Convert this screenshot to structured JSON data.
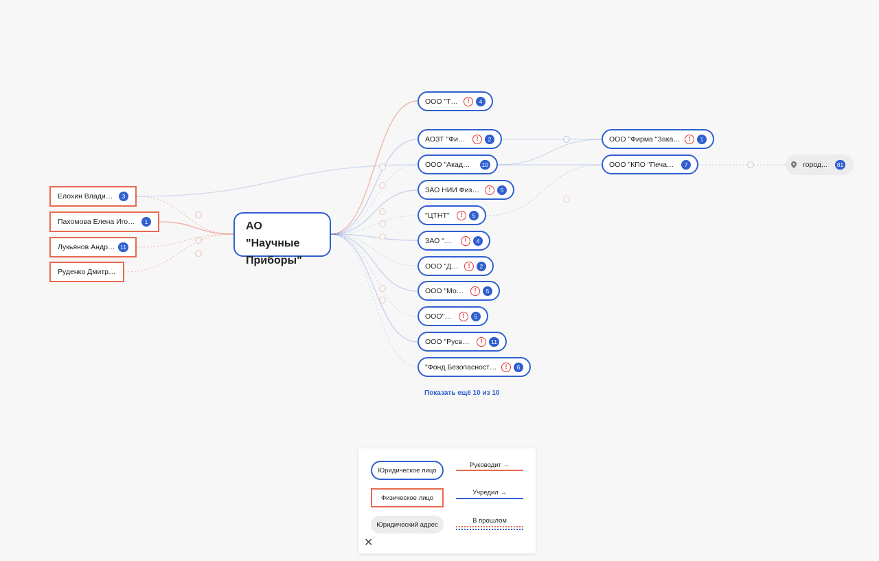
{
  "center": {
    "label": "АО \"Научные Приборы\""
  },
  "persons": [
    {
      "id": "p1",
      "label": "Елохин Владимир...",
      "badge": "3"
    },
    {
      "id": "p2",
      "label": "Пахомова Елена Игоревна",
      "badge": "1"
    },
    {
      "id": "p3",
      "label": "Лукьянов Андрей...",
      "badge": "11"
    },
    {
      "id": "p4",
      "label": "Руденко Дмитрий..."
    }
  ],
  "companies": [
    {
      "id": "c1",
      "label": "ООО \"ТДАЭ\"",
      "warn": true,
      "badge": "4"
    },
    {
      "id": "c2",
      "label": "АОЗТ \"Фирма...",
      "warn": true,
      "badge": "2"
    },
    {
      "id": "c3",
      "label": "ООО \"Академия\"",
      "warn": false,
      "badge": "10"
    },
    {
      "id": "c4",
      "label": "ЗАО НИИ Физики...",
      "warn": true,
      "badge": "5"
    },
    {
      "id": "c5",
      "label": "\"ЦТНТ\"",
      "warn": true,
      "badge": "5"
    },
    {
      "id": "c6",
      "label": "ЗАО \"СКБ...",
      "warn": true,
      "badge": "4"
    },
    {
      "id": "c7",
      "label": "ООО \"Джем\"",
      "warn": true,
      "badge": "2"
    },
    {
      "id": "c8",
      "label": "ООО \"Модус+\"",
      "warn": true,
      "badge": "5"
    },
    {
      "id": "c9",
      "label": "ООО\"ЦСП\"",
      "warn": true,
      "badge": "5"
    },
    {
      "id": "c10",
      "label": "ООО \"Русвэйко\"",
      "warn": true,
      "badge": "11"
    },
    {
      "id": "c11",
      "label": "\"Фонд Безопасности и...",
      "warn": true,
      "badge": "6"
    }
  ],
  "second_level": [
    {
      "id": "s1",
      "label": "ООО \"Фирма \"Заказчик\"",
      "warn": true,
      "badge": "1"
    },
    {
      "id": "s2",
      "label": "ООО \"КПО \"Печатные...",
      "warn": false,
      "badge": "7"
    }
  ],
  "address": {
    "label": "город...",
    "badge": "81",
    "icon": "map-pin-icon"
  },
  "warn_symbol": "!",
  "show_more": "Показать ещё 10 из 10",
  "legend": {
    "legal": "Юридическое лицо",
    "person": "Физическое лицо",
    "address": "Юридический адрес",
    "manages": "Руководит →",
    "founded": "Учредил →",
    "past": "В прошлом",
    "close": "✕"
  },
  "colors": {
    "legal": "#2f5fd0",
    "person": "#e8694f",
    "badge": "#2f5fd0",
    "warning": "#e03535",
    "address_bg": "#ececec"
  }
}
